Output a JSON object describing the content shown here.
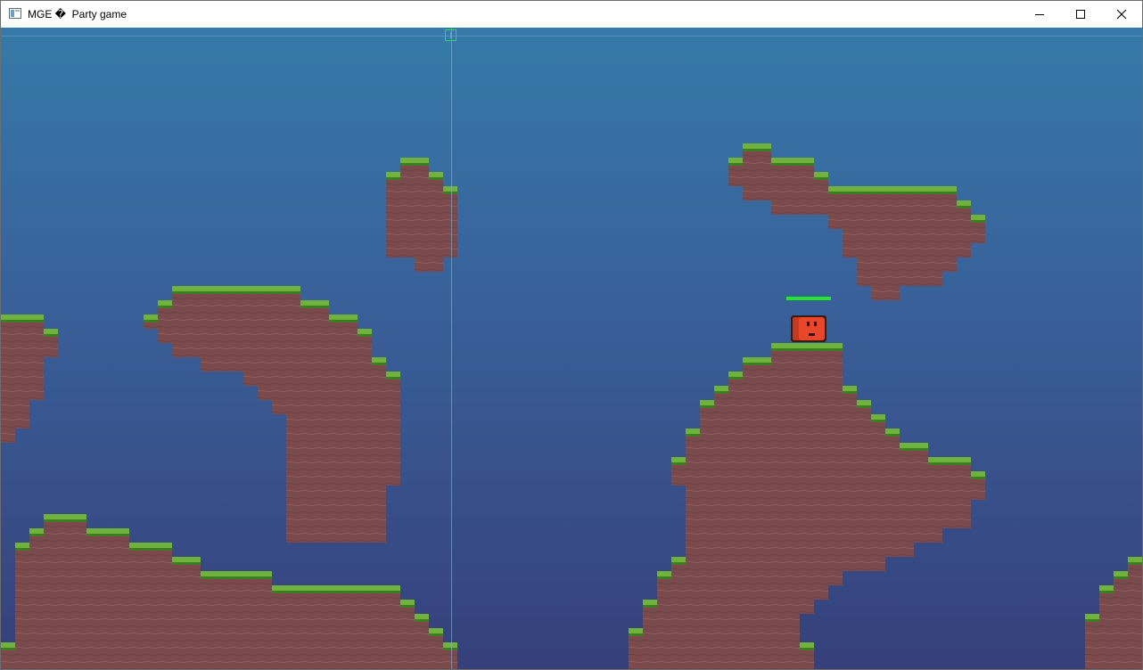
{
  "window": {
    "title": "MGE �  Party game",
    "controls": {
      "minimize": "minimize-icon",
      "maximize": "maximize-icon",
      "close": "close-icon"
    }
  },
  "game": {
    "sky_colors": {
      "top": "#357aa8",
      "middle": "#395f98",
      "bottom": "#36407a"
    },
    "terrain_colors": {
      "dirt": "#7b4a4c",
      "dirt_stripe": "#8c585a",
      "grass": "#6fb23c",
      "grass_dark": "#3f7a24"
    },
    "player": {
      "color": "#e8472a",
      "outline": "#3b1a12",
      "health_fraction": 1.0,
      "health_color": "#25e62a"
    },
    "debug_color": "#2fd65c"
  }
}
